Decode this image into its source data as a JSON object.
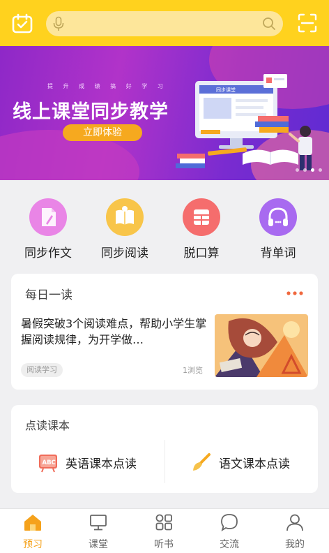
{
  "header": {
    "search_placeholder": ""
  },
  "banner": {
    "subtitle": "提 升 成 绩 搞 好 学 习",
    "title": "线上课堂同步教学",
    "button": "立即体验",
    "screen_label": "同步课堂",
    "page_dots": 4,
    "active_dot": 3
  },
  "features": [
    {
      "label": "同步作文",
      "icon": "pen-document-icon",
      "color": "#e985e6"
    },
    {
      "label": "同步阅读",
      "icon": "open-book-icon",
      "color": "#f8c54a"
    },
    {
      "label": "脱口算",
      "icon": "calculator-grid-icon",
      "color": "#f56d6d"
    },
    {
      "label": "背单词",
      "icon": "headphones-icon",
      "color": "#a86af0"
    }
  ],
  "daily": {
    "title": "每日一读",
    "article_title": "暑假突破3个阅读难点，帮助小学生掌握阅读规律，为开学做…",
    "tag": "阅读学习",
    "views": "1浏览"
  },
  "reading": {
    "title": "点读课本",
    "english": "英语课本点读",
    "chinese": "语文课本点读"
  },
  "tabs": [
    {
      "label": "预习",
      "icon": "home-icon",
      "active": true
    },
    {
      "label": "课堂",
      "icon": "monitor-icon",
      "active": false
    },
    {
      "label": "听书",
      "icon": "grid-apps-icon",
      "active": false
    },
    {
      "label": "交流",
      "icon": "chat-bubble-icon",
      "active": false
    },
    {
      "label": "我的",
      "icon": "user-icon",
      "active": false
    }
  ],
  "colors": {
    "header": "#ffd21e",
    "accent": "#f5a21b",
    "banner_button": "#f6a91f"
  }
}
